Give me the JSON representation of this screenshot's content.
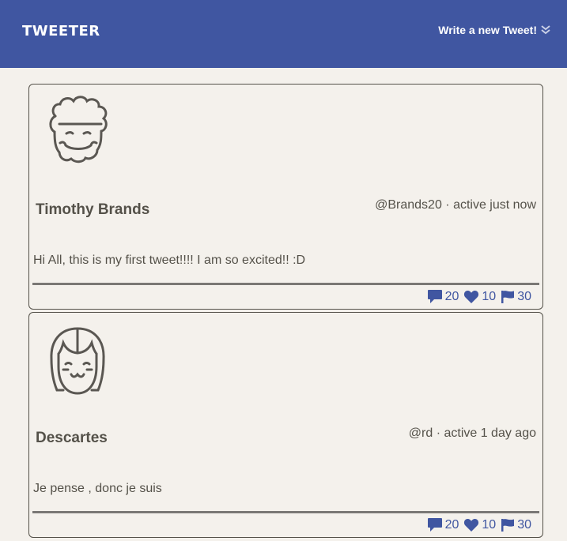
{
  "header": {
    "brand": "TWEETER",
    "compose_label": "Write a new Tweet!"
  },
  "colors": {
    "navbar": "#4056a1",
    "page_background": "#f4f1ec",
    "text": "#545149",
    "accent": "#4056a1"
  },
  "tweets": [
    {
      "name": "Timothy Brands",
      "handle_line": "@Brands20 · active just now",
      "text": "Hi All, this is my first tweet!!!! I am so excited!! :D",
      "avatar_icon": "curly-hair-face-icon",
      "comments": "20",
      "likes": "10",
      "flags": "30"
    },
    {
      "name": "Descartes",
      "handle_line": "@rd · active 1 day ago",
      "text": "Je pense , donc je suis",
      "avatar_icon": "bob-hair-face-icon",
      "comments": "20",
      "likes": "10",
      "flags": "30"
    }
  ]
}
